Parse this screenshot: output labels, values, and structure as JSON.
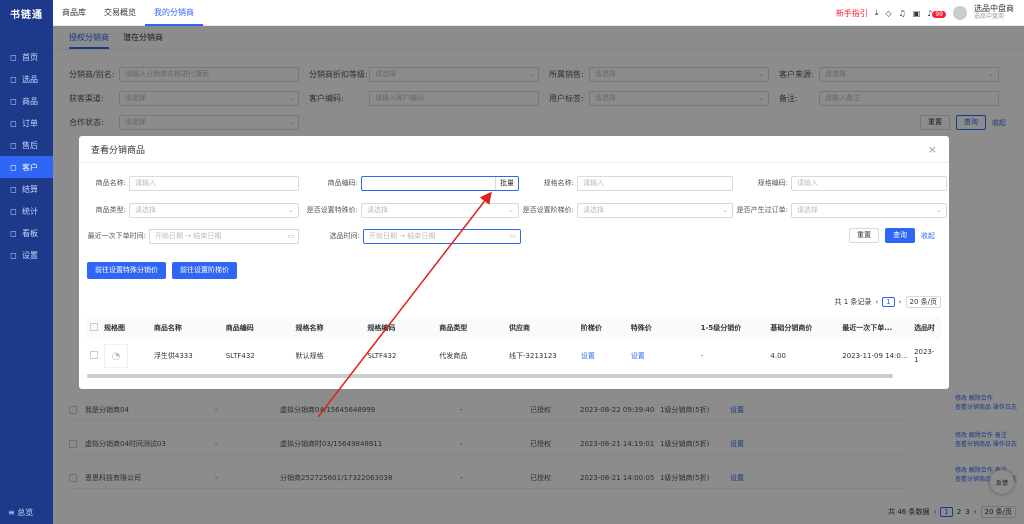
{
  "app": {
    "logo": "书链通",
    "user_name": "选品中盘商",
    "user_sub": "选品中盘商",
    "guide": "新手指引",
    "badge": "99"
  },
  "sidebar": {
    "items": [
      {
        "icon": "◻",
        "label": "首页"
      },
      {
        "icon": "◻",
        "label": "选品"
      },
      {
        "icon": "◻",
        "label": "商品"
      },
      {
        "icon": "◻",
        "label": "订单"
      },
      {
        "icon": "◻",
        "label": "售后"
      },
      {
        "icon": "◻",
        "label": "客户"
      },
      {
        "icon": "◻",
        "label": "结算"
      },
      {
        "icon": "◻",
        "label": "统计"
      },
      {
        "icon": "◻",
        "label": "看板"
      },
      {
        "icon": "◻",
        "label": "设置"
      }
    ],
    "bottom": "≡ 总览"
  },
  "topbar": {
    "tabs": [
      "商品库",
      "交易概览",
      "我的分销商"
    ]
  },
  "main": {
    "subtabs": [
      "授权分销商",
      "潜在分销商"
    ],
    "filters": {
      "r1": [
        {
          "label": "分销商/别名:",
          "placeholder": "请输入分销商名称进行搜索"
        },
        {
          "label": "分销商折扣等级:",
          "placeholder": "请选择"
        },
        {
          "label": "所属销售:",
          "placeholder": "请选择"
        },
        {
          "label": "客户来源:",
          "placeholder": "请选择"
        }
      ],
      "r2": [
        {
          "label": "获客渠道:",
          "placeholder": "请选择"
        },
        {
          "label": "客户编码:",
          "placeholder": "请输入客户编码"
        },
        {
          "label": "用户标签:",
          "placeholder": "请选择"
        },
        {
          "label": "备注:",
          "placeholder": "请输入备注"
        }
      ],
      "r3": [
        {
          "label": "合作状态:",
          "placeholder": "请选择"
        }
      ]
    },
    "reset": "重置",
    "query": "查询",
    "collapse": "收起",
    "rows": [
      {
        "name": "我是分销商04",
        "code": "-",
        "account": "虚拟分销商04/15645648999",
        "type": "-",
        "status": "已授权",
        "time": "2023-08-22 09:39:40",
        "level": "1级分销商(5折)",
        "price": "设置"
      },
      {
        "name": "虚拟分销商04时间测试03",
        "code": "-",
        "account": "虚拟分销商时03/15649848911",
        "type": "-",
        "status": "已授权",
        "time": "2023-08-21 14:19:01",
        "level": "1级分销商(5折)",
        "price": "设置"
      },
      {
        "name": "恩恩科技有限公司",
        "code": "-",
        "account": "分销商252725601/17322063038",
        "type": "-",
        "status": "已授权",
        "time": "2023-08-21 14:00:05",
        "level": "1级分销商(5折)",
        "price": "设置"
      }
    ],
    "ops": [
      "修改 解除合作",
      "查看分销商品 操作日志",
      "修改 解除合作 备注",
      "查看分销商品 操作日志"
    ],
    "total": "共 46 条数据",
    "pages": [
      "1",
      "2",
      "3"
    ],
    "page_size": "20 条/页",
    "feedback": "反馈"
  },
  "modal": {
    "title": "查看分销商品",
    "close": "×",
    "f1": [
      {
        "label": "商品名称:",
        "placeholder": "请输入"
      },
      {
        "label": "商品编码:",
        "placeholder": "",
        "suffix": "批量"
      },
      {
        "label": "规格名称:",
        "placeholder": "请输入"
      },
      {
        "label": "规格编码:",
        "placeholder": "请输入"
      }
    ],
    "f2": [
      {
        "label": "商品类型:",
        "placeholder": "请选择"
      },
      {
        "label": "是否设置特殊价:",
        "placeholder": "请选择"
      },
      {
        "label": "是否设置阶梯价:",
        "placeholder": "请选择"
      },
      {
        "label": "是否产生过订单:",
        "placeholder": "请选择"
      }
    ],
    "f3": [
      {
        "label": "最近一次下单时间:",
        "start": "开始日期",
        "end": "结束日期"
      },
      {
        "label": "选品时间:",
        "start": "开始日期",
        "end": "结束日期"
      }
    ],
    "reset": "重置",
    "query": "查询",
    "collapse": "收起",
    "btn_special": "前往设置特殊分销价",
    "btn_tier": "前往设置阶梯价",
    "total": "共 1 条记录",
    "page": "1",
    "page_size": "20 条/页",
    "columns": [
      "规格图",
      "商品名称",
      "商品编码",
      "规格名称",
      "规格编码",
      "商品类型",
      "供应商",
      "阶梯价",
      "特殊价",
      "1-5级分销价",
      "基础分销商价",
      "最近一次下单...",
      "选品时"
    ],
    "row": {
      "name": "浮生供4333",
      "code": "SLTF432",
      "spec": "默认规格",
      "spec_code": "SLTF432",
      "type": "代发商品",
      "supplier": "线下-3213123",
      "tier": "设置",
      "special": "设置",
      "level": "-",
      "base": "4.00",
      "last": "2023-11-09 14:0...",
      "pick": "2023-1"
    }
  }
}
